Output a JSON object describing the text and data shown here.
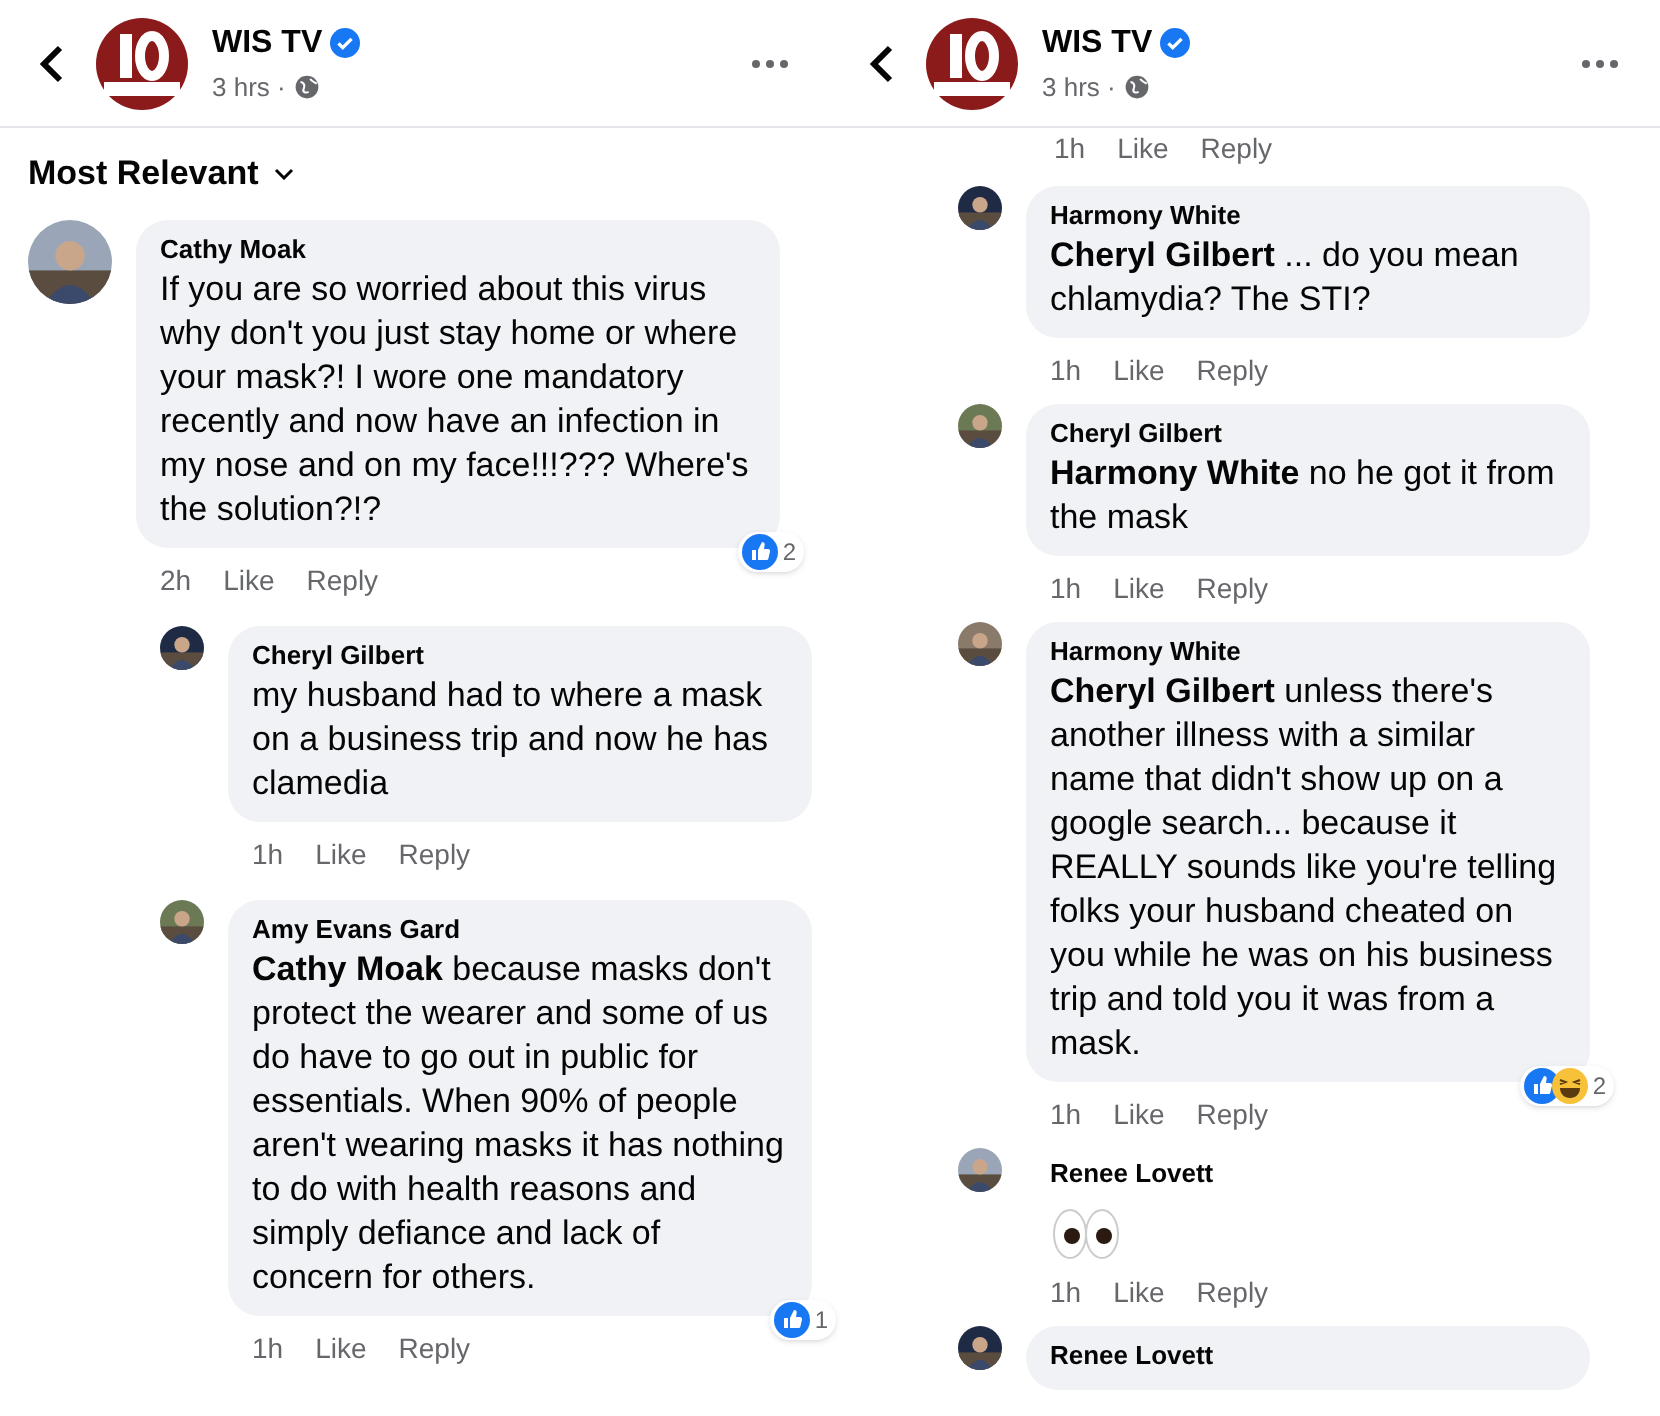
{
  "panels": [
    {
      "header": {
        "page_name": "WIS TV",
        "verified": true,
        "time": "3 hrs ·"
      },
      "sort": {
        "label": "Most Relevant"
      },
      "comments": [
        {
          "kind": "text",
          "author": "Cathy Moak",
          "text": "If you are so worried about this virus why don't you just stay home or where your mask?! I wore one mandatory recently and now have an infection in my nose and on my face!!!??? Where's the solution?!?",
          "time": "2h",
          "like": "Like",
          "reply": "Reply",
          "reactions": [
            {
              "kind": "like"
            }
          ],
          "reaction_count": "2",
          "replies": [
            {
              "kind": "text",
              "author": "Cheryl Gilbert",
              "text": "my husband had to where a mask on a business trip and now he has clamedia",
              "time": "1h",
              "like": "Like",
              "reply": "Reply"
            },
            {
              "kind": "text",
              "author": "Amy Evans Gard",
              "text": "**Cathy Moak** because masks don't protect the wearer and some of us do have to go out in public for essentials. When 90% of people aren't wearing masks it has nothing to do with health reasons and simply defiance and lack of concern for others.",
              "time": "1h",
              "like": "Like",
              "reply": "Reply",
              "reactions": [
                {
                  "kind": "like"
                }
              ],
              "reaction_count": "1"
            }
          ]
        }
      ]
    },
    {
      "header": {
        "page_name": "WIS TV",
        "verified": true,
        "time": "3 hrs ·"
      },
      "partial_actions": {
        "time": "1h",
        "like": "Like",
        "reply": "Reply"
      },
      "replies": [
        {
          "kind": "text",
          "author": "Harmony White",
          "text": "**Cheryl Gilbert** ... do you mean chlamydia? The STI?",
          "time": "1h",
          "like": "Like",
          "reply": "Reply"
        },
        {
          "kind": "text",
          "author": "Cheryl Gilbert",
          "text": "**Harmony White** no he got it from the mask",
          "time": "1h",
          "like": "Like",
          "reply": "Reply"
        },
        {
          "kind": "text",
          "author": "Harmony White",
          "text": "**Cheryl Gilbert** unless there's another illness with a similar name that didn't show up on a google search... because it REALLY sounds like you're telling folks your husband cheated on you while he was on his business trip and told you it was from a mask.",
          "time": "1h",
          "like": "Like",
          "reply": "Reply",
          "reactions": [
            {
              "kind": "like"
            },
            {
              "kind": "haha"
            }
          ],
          "reaction_count": "2"
        },
        {
          "kind": "eyes",
          "author": "Renee Lovett",
          "time": "1h",
          "like": "Like",
          "reply": "Reply"
        },
        {
          "kind": "text",
          "author": "Renee Lovett"
        }
      ]
    }
  ]
}
